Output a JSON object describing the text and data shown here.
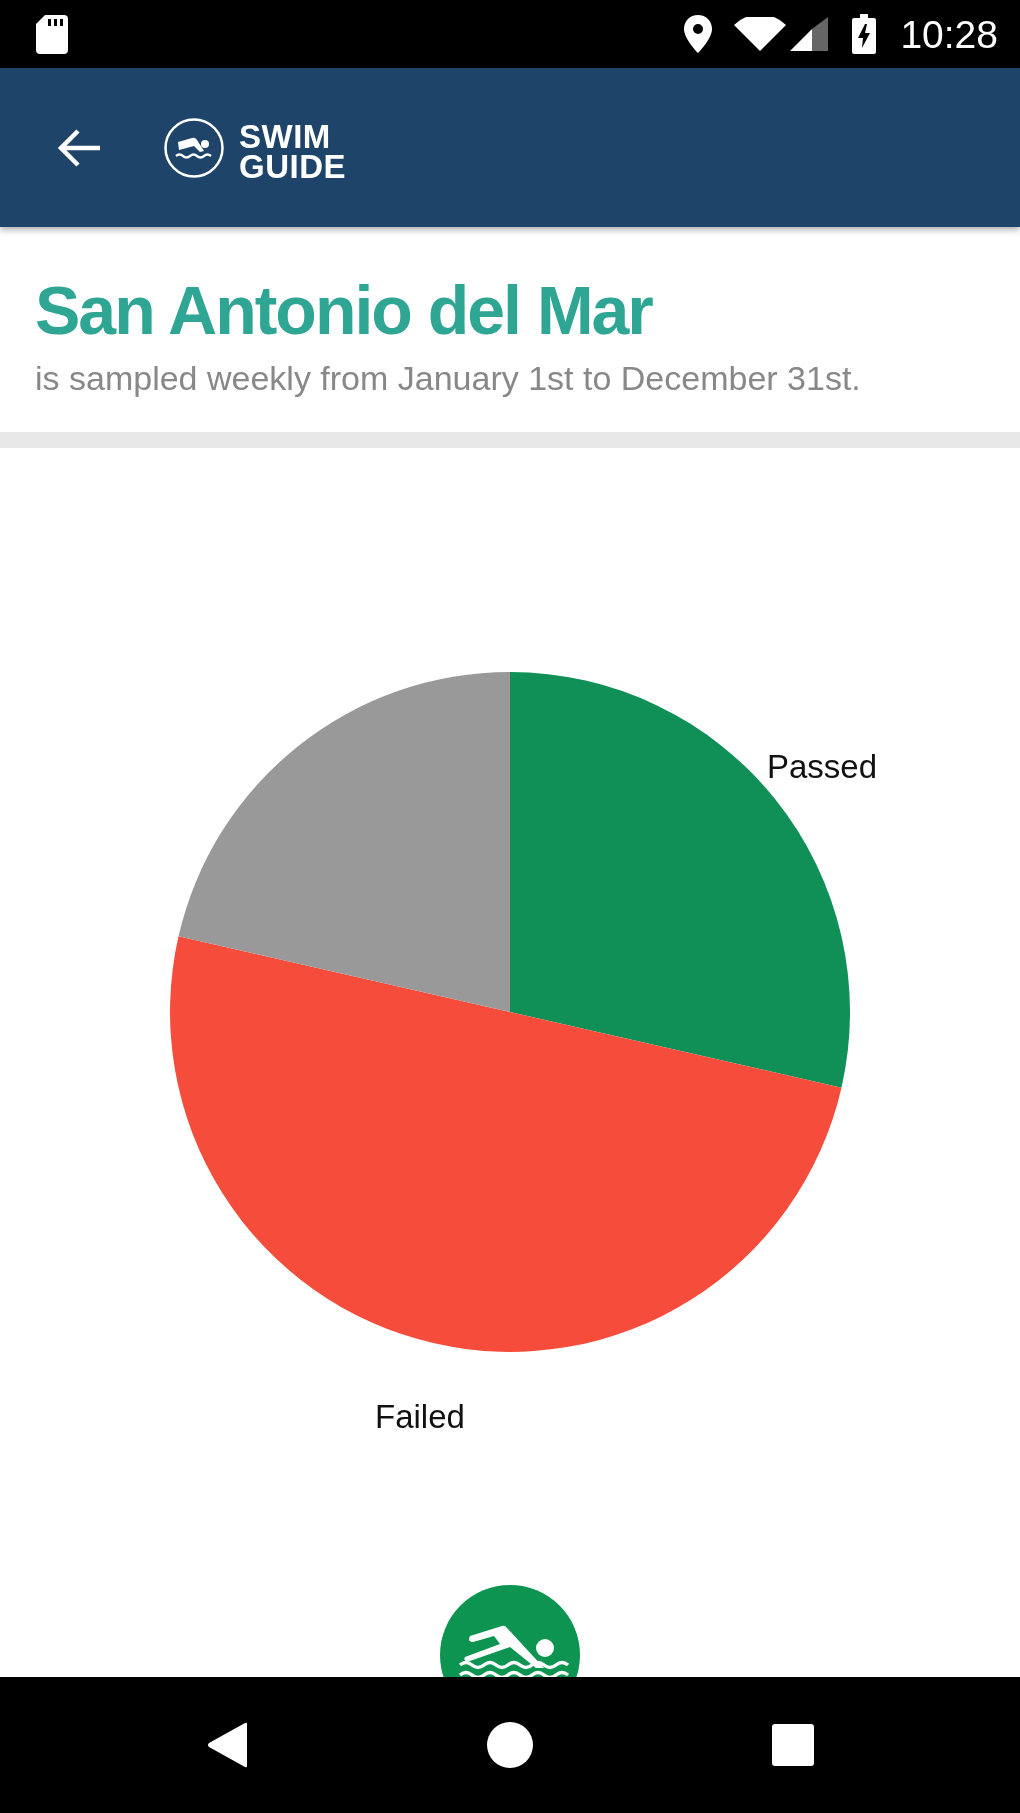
{
  "status_bar": {
    "time": "10:28"
  },
  "app_bar": {
    "logo_lines": [
      "SWIM",
      "GUIDE"
    ]
  },
  "beach": {
    "name": "San Antonio del Mar",
    "schedule": "is sampled weekly from January 1st to December 31st."
  },
  "chart": {
    "slices": [
      {
        "label": "Passed",
        "color": "#108f57"
      },
      {
        "label": "Failed",
        "color": "#f54c3b"
      },
      {
        "color": "#999999"
      }
    ]
  }
}
